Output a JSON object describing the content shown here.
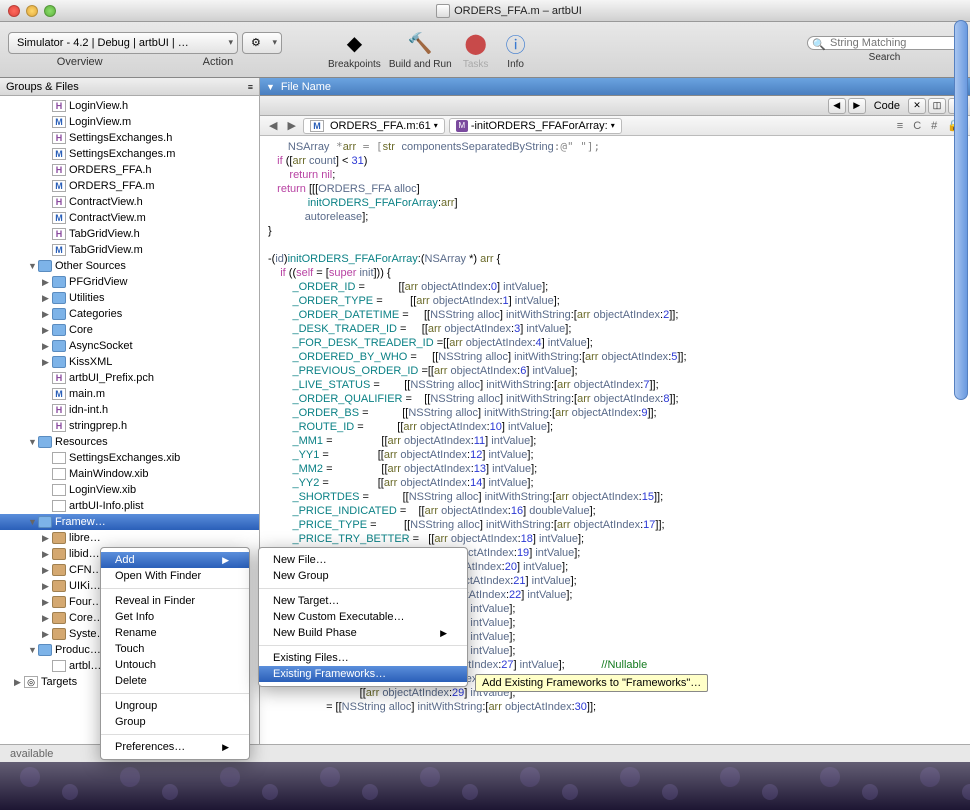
{
  "window": {
    "title": "ORDERS_FFA.m – artbUI"
  },
  "toolbar": {
    "scheme": "Simulator - 4.2 | Debug | artbUI | …",
    "overview_label": "Overview",
    "action_label": "Action",
    "breakpoints_label": "Breakpoints",
    "build_run_label": "Build and Run",
    "tasks_label": "Tasks",
    "info_label": "Info",
    "search_label": "Search",
    "search_placeholder": "String Matching"
  },
  "sidebar": {
    "header": "Groups & Files",
    "items": [
      {
        "indent": 3,
        "icon": "h",
        "label": "LoginView.h"
      },
      {
        "indent": 3,
        "icon": "m",
        "label": "LoginView.m"
      },
      {
        "indent": 3,
        "icon": "h",
        "label": "SettingsExchanges.h"
      },
      {
        "indent": 3,
        "icon": "m",
        "label": "SettingsExchanges.m"
      },
      {
        "indent": 3,
        "icon": "h",
        "label": "ORDERS_FFA.h"
      },
      {
        "indent": 3,
        "icon": "m",
        "label": "ORDERS_FFA.m"
      },
      {
        "indent": 3,
        "icon": "h",
        "label": "ContractView.h"
      },
      {
        "indent": 3,
        "icon": "m",
        "label": "ContractView.m"
      },
      {
        "indent": 3,
        "icon": "h",
        "label": "TabGridView.h"
      },
      {
        "indent": 3,
        "icon": "m",
        "label": "TabGridView.m"
      },
      {
        "indent": 2,
        "icon": "folder",
        "label": "Other Sources",
        "disc": "▼"
      },
      {
        "indent": 3,
        "icon": "folder",
        "label": "PFGridView",
        "disc": "▶"
      },
      {
        "indent": 3,
        "icon": "folder",
        "label": "Utilities",
        "disc": "▶"
      },
      {
        "indent": 3,
        "icon": "folder",
        "label": "Categories",
        "disc": "▶"
      },
      {
        "indent": 3,
        "icon": "folder",
        "label": "Core",
        "disc": "▶"
      },
      {
        "indent": 3,
        "icon": "folder",
        "label": "AsyncSocket",
        "disc": "▶"
      },
      {
        "indent": 3,
        "icon": "folder",
        "label": "KissXML",
        "disc": "▶"
      },
      {
        "indent": 3,
        "icon": "h",
        "label": "artbUI_Prefix.pch"
      },
      {
        "indent": 3,
        "icon": "m",
        "label": "main.m"
      },
      {
        "indent": 3,
        "icon": "h",
        "label": "idn-int.h"
      },
      {
        "indent": 3,
        "icon": "h",
        "label": "stringprep.h"
      },
      {
        "indent": 2,
        "icon": "folder",
        "label": "Resources",
        "disc": "▼"
      },
      {
        "indent": 3,
        "icon": "xib",
        "label": "SettingsExchanges.xib"
      },
      {
        "indent": 3,
        "icon": "xib",
        "label": "MainWindow.xib"
      },
      {
        "indent": 3,
        "icon": "xib",
        "label": "LoginView.xib"
      },
      {
        "indent": 3,
        "icon": "xib",
        "label": "artbUI-Info.plist"
      },
      {
        "indent": 2,
        "icon": "folder",
        "label": "Framew…",
        "disc": "▼",
        "selected": true
      },
      {
        "indent": 3,
        "icon": "suitcase",
        "label": "libre…",
        "disc": "▶"
      },
      {
        "indent": 3,
        "icon": "suitcase",
        "label": "libid…",
        "disc": "▶"
      },
      {
        "indent": 3,
        "icon": "suitcase",
        "label": "CFN…",
        "disc": "▶"
      },
      {
        "indent": 3,
        "icon": "suitcase",
        "label": "UIKi…",
        "disc": "▶"
      },
      {
        "indent": 3,
        "icon": "suitcase",
        "label": "Four…",
        "disc": "▶"
      },
      {
        "indent": 3,
        "icon": "suitcase",
        "label": "Core…",
        "disc": "▶"
      },
      {
        "indent": 3,
        "icon": "suitcase",
        "label": "Syste…",
        "disc": "▶"
      },
      {
        "indent": 2,
        "icon": "folder",
        "label": "Produc…",
        "disc": "▼"
      },
      {
        "indent": 3,
        "icon": "xib",
        "label": "artbl…"
      },
      {
        "indent": 1,
        "icon": "target",
        "label": "Targets",
        "disc": "▶"
      }
    ]
  },
  "editor": {
    "file_header": "File Name",
    "code_toolbar": "Code",
    "crumb_file": "ORDERS_FFA.m:61",
    "crumb_method": "-initORDERS_FFAForArray:"
  },
  "context_menu_1": {
    "items": [
      "Add",
      "Open With Finder",
      "Reveal in Finder",
      "Get Info",
      "Rename",
      "Touch",
      "Untouch",
      "Delete",
      "Ungroup",
      "Group",
      "Preferences…"
    ],
    "highlighted": 0,
    "has_submenu": [
      0,
      10
    ]
  },
  "context_menu_2": {
    "items": [
      "New File…",
      "New Group",
      "New Target…",
      "New Custom Executable…",
      "New Build Phase",
      "Existing Files…",
      "Existing Frameworks…"
    ],
    "highlighted": 6,
    "has_submenu": [
      4
    ]
  },
  "tooltip": "Add Existing Frameworks to \"Frameworks\"…",
  "status": "available",
  "code_lines": [
    {
      "t": "   NSArray *arr = [str componentsSeparatedByString:@\" \"];",
      "c": "code-sel"
    },
    {
      "t": "   if ([arr count] < 31)"
    },
    {
      "t": "       return nil;"
    },
    {
      "t": "   return [[[ORDERS_FFA alloc]"
    },
    {
      "t": "             initORDERS_FFAForArray:arr]"
    },
    {
      "t": "            autorelease];"
    },
    {
      "t": "}"
    },
    {
      "t": ""
    },
    {
      "t": "-(id)initORDERS_FFAForArray:(NSArray *) arr {"
    },
    {
      "t": "    if ((self = [super init])) {"
    },
    {
      "t": "        _ORDER_ID =           [[arr objectAtIndex:0] intValue];"
    },
    {
      "t": "        _ORDER_TYPE =         [[arr objectAtIndex:1] intValue];"
    },
    {
      "t": "        _ORDER_DATETIME =     [[NSString alloc] initWithString:[arr objectAtIndex:2]];"
    },
    {
      "t": "        _DESK_TRADER_ID =     [[arr objectAtIndex:3] intValue];"
    },
    {
      "t": "        _FOR_DESK_TREADER_ID =[[arr objectAtIndex:4] intValue];"
    },
    {
      "t": "        _ORDERED_BY_WHO =     [[NSString alloc] initWithString:[arr objectAtIndex:5]];"
    },
    {
      "t": "        _PREVIOUS_ORDER_ID =[[arr objectAtIndex:6] intValue];"
    },
    {
      "t": "        _LIVE_STATUS =        [[NSString alloc] initWithString:[arr objectAtIndex:7]];"
    },
    {
      "t": "        _ORDER_QUALIFIER =    [[NSString alloc] initWithString:[arr objectAtIndex:8]];"
    },
    {
      "t": "        _ORDER_BS =           [[NSString alloc] initWithString:[arr objectAtIndex:9]];"
    },
    {
      "t": "        _ROUTE_ID =           [[arr objectAtIndex:10] intValue];"
    },
    {
      "t": "        _MM1 =                [[arr objectAtIndex:11] intValue];"
    },
    {
      "t": "        _YY1 =                [[arr objectAtIndex:12] intValue];"
    },
    {
      "t": "        _MM2 =                [[arr objectAtIndex:13] intValue];"
    },
    {
      "t": "        _YY2 =                [[arr objectAtIndex:14] intValue];"
    },
    {
      "t": "        _SHORTDES =           [[NSString alloc] initWithString:[arr objectAtIndex:15]];"
    },
    {
      "t": "        _PRICE_INDICATED =    [[arr objectAtIndex:16] doubleValue];"
    },
    {
      "t": "        _PRICE_TYPE =         [[NSString alloc] initWithString:[arr objectAtIndex:17]];"
    },
    {
      "t": "        _PRICE_TRY_BETTER =   [[arr objectAtIndex:18] intValue];"
    },
    {
      "t": "        _ORDER_QUANTITY =     [[arr objectAtIndex:19] intValue];"
    },
    {
      "t": "        _DAY_QUALIFIER =      [[arr objectAtIndex:20] intValue];"
    },
    {
      "t": "        _FLEXIBLE_QUANTITY =[[arr objectAtIndex:21] intValue];"
    },
    {
      "t": "        _QUANTITY_STEP =      [[arr objectAtIndex:22] intValue];"
    },
    {
      "t": "                              [[arr objectAtIndex:23] intValue];"
    },
    {
      "t": "                              [[arr objectAtIndex:24] intValue];"
    },
    {
      "t": "                              [[arr objectAtIndex:25] intValue];"
    },
    {
      "t": "                              [[arr objectAtIndex:26] intValue];"
    },
    {
      "t": "                   _EXECUTION = [[arr objectAtIndex:27] intValue];            //Nullable"
    },
    {
      "t": "             _EXCHANGE = [[arr objectAtIndex:28] intValue];            //Nullable"
    },
    {
      "t": "                              [[arr objectAtIndex:29] intValue];"
    },
    {
      "t": "                   = [[NSString alloc] initWithString:[arr objectAtIndex:30]];"
    }
  ]
}
